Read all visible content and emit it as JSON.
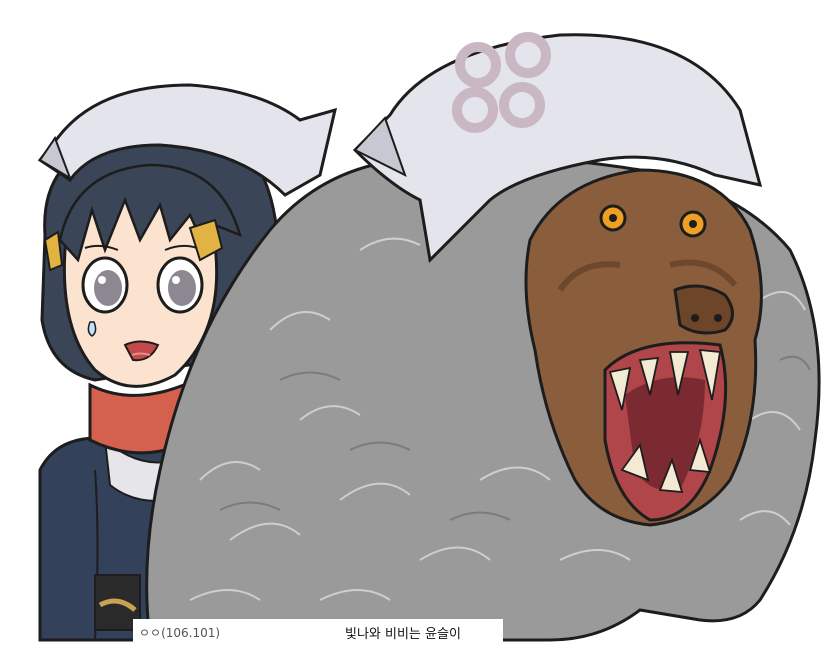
{
  "caption": {
    "author": "ㅇㅇ(106.101)",
    "text": "빛나와 비비는 윤슬이"
  },
  "figures": {
    "left": "girl-with-white-headscarf-icon",
    "right": "baboon-with-white-headscarf-icon"
  },
  "colors": {
    "background": "#ffffff",
    "fur": "#9a9a9a",
    "headscarf": "#e4e4ec",
    "girl_hair": "#3a4558",
    "scarf_red": "#d4604e",
    "baboon_face": "#8a5e3c",
    "eye_orange": "#f0a020"
  }
}
